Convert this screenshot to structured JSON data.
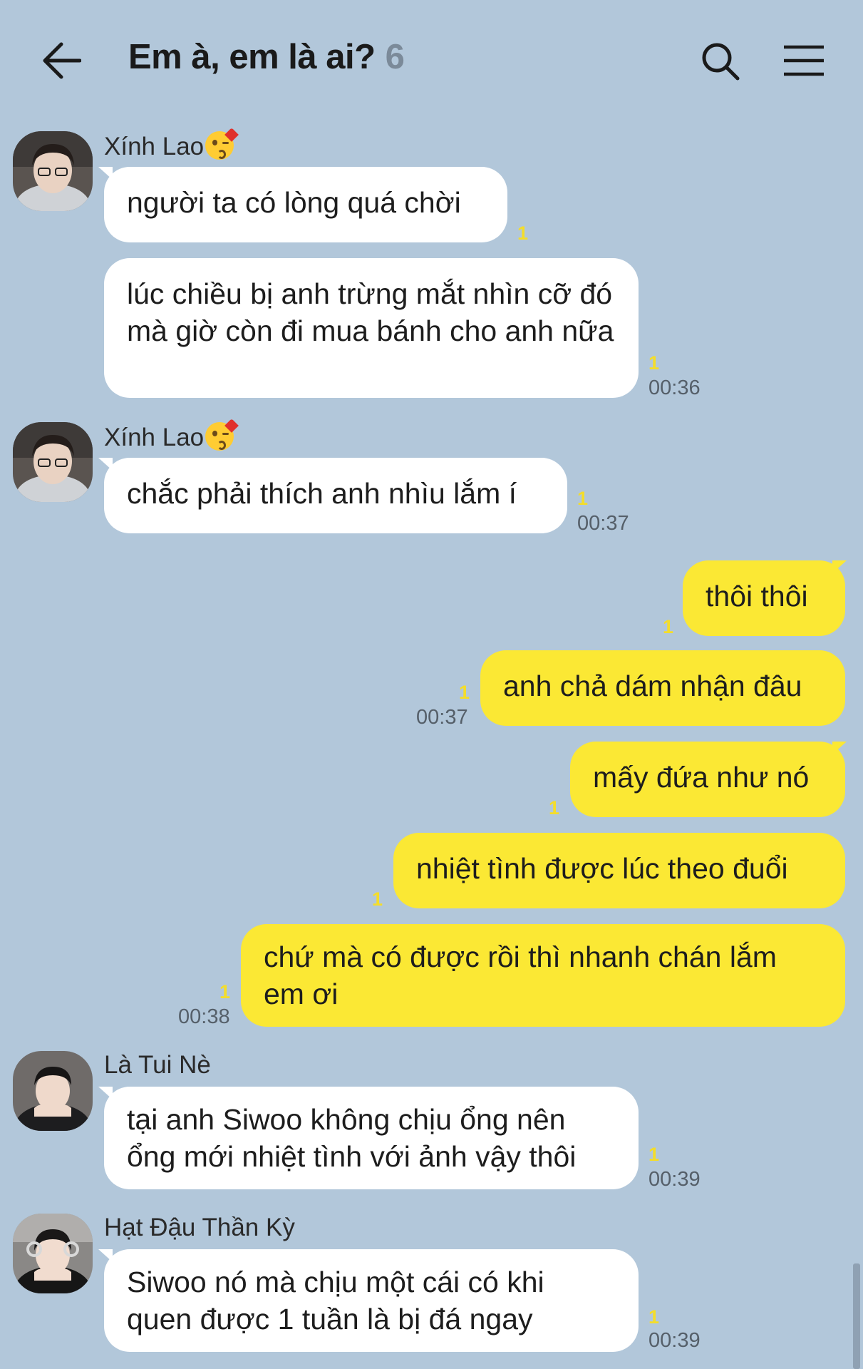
{
  "header": {
    "title": "Em à, em là ai?",
    "member_count": "6"
  },
  "messages": [
    {
      "sender": "Xính Lao",
      "text": "người ta có lòng quá chời",
      "unread": "1"
    },
    {
      "text": "lúc chiều bị anh trừng mắt nhìn cỡ đó mà giờ còn đi mua bánh cho anh nữa",
      "unread": "1",
      "time": "00:36"
    },
    {
      "sender": "Xính Lao",
      "text": "chắc phải thích anh nhìu lắm í",
      "unread": "1",
      "time": "00:37"
    },
    {
      "text": "thôi thôi",
      "unread": "1"
    },
    {
      "text": "anh chả dám nhận đâu",
      "unread": "1",
      "time": "00:37"
    },
    {
      "text": "mấy đứa như nó",
      "unread": "1"
    },
    {
      "text": "nhiệt tình được lúc theo đuổi",
      "unread": "1"
    },
    {
      "text": "chứ mà có được rồi thì nhanh chán lắm em ơi",
      "unread": "1",
      "time": "00:38"
    },
    {
      "sender": "Là Tui Nè",
      "text": "tại anh Siwoo không chịu ổng nên ổng mới nhiệt tình với ảnh vậy thôi",
      "unread": "1",
      "time": "00:39"
    },
    {
      "sender": "Hạt Đậu Thần Kỳ",
      "text": "Siwoo nó mà chịu một cái có khi quen được 1 tuần là bị đá ngay",
      "unread": "1",
      "time": "00:39"
    }
  ],
  "colors": {
    "background": "#b2c7da",
    "incoming_bubble": "#ffffff",
    "outgoing_bubble": "#fbe834",
    "unread": "#f4dd2a"
  }
}
